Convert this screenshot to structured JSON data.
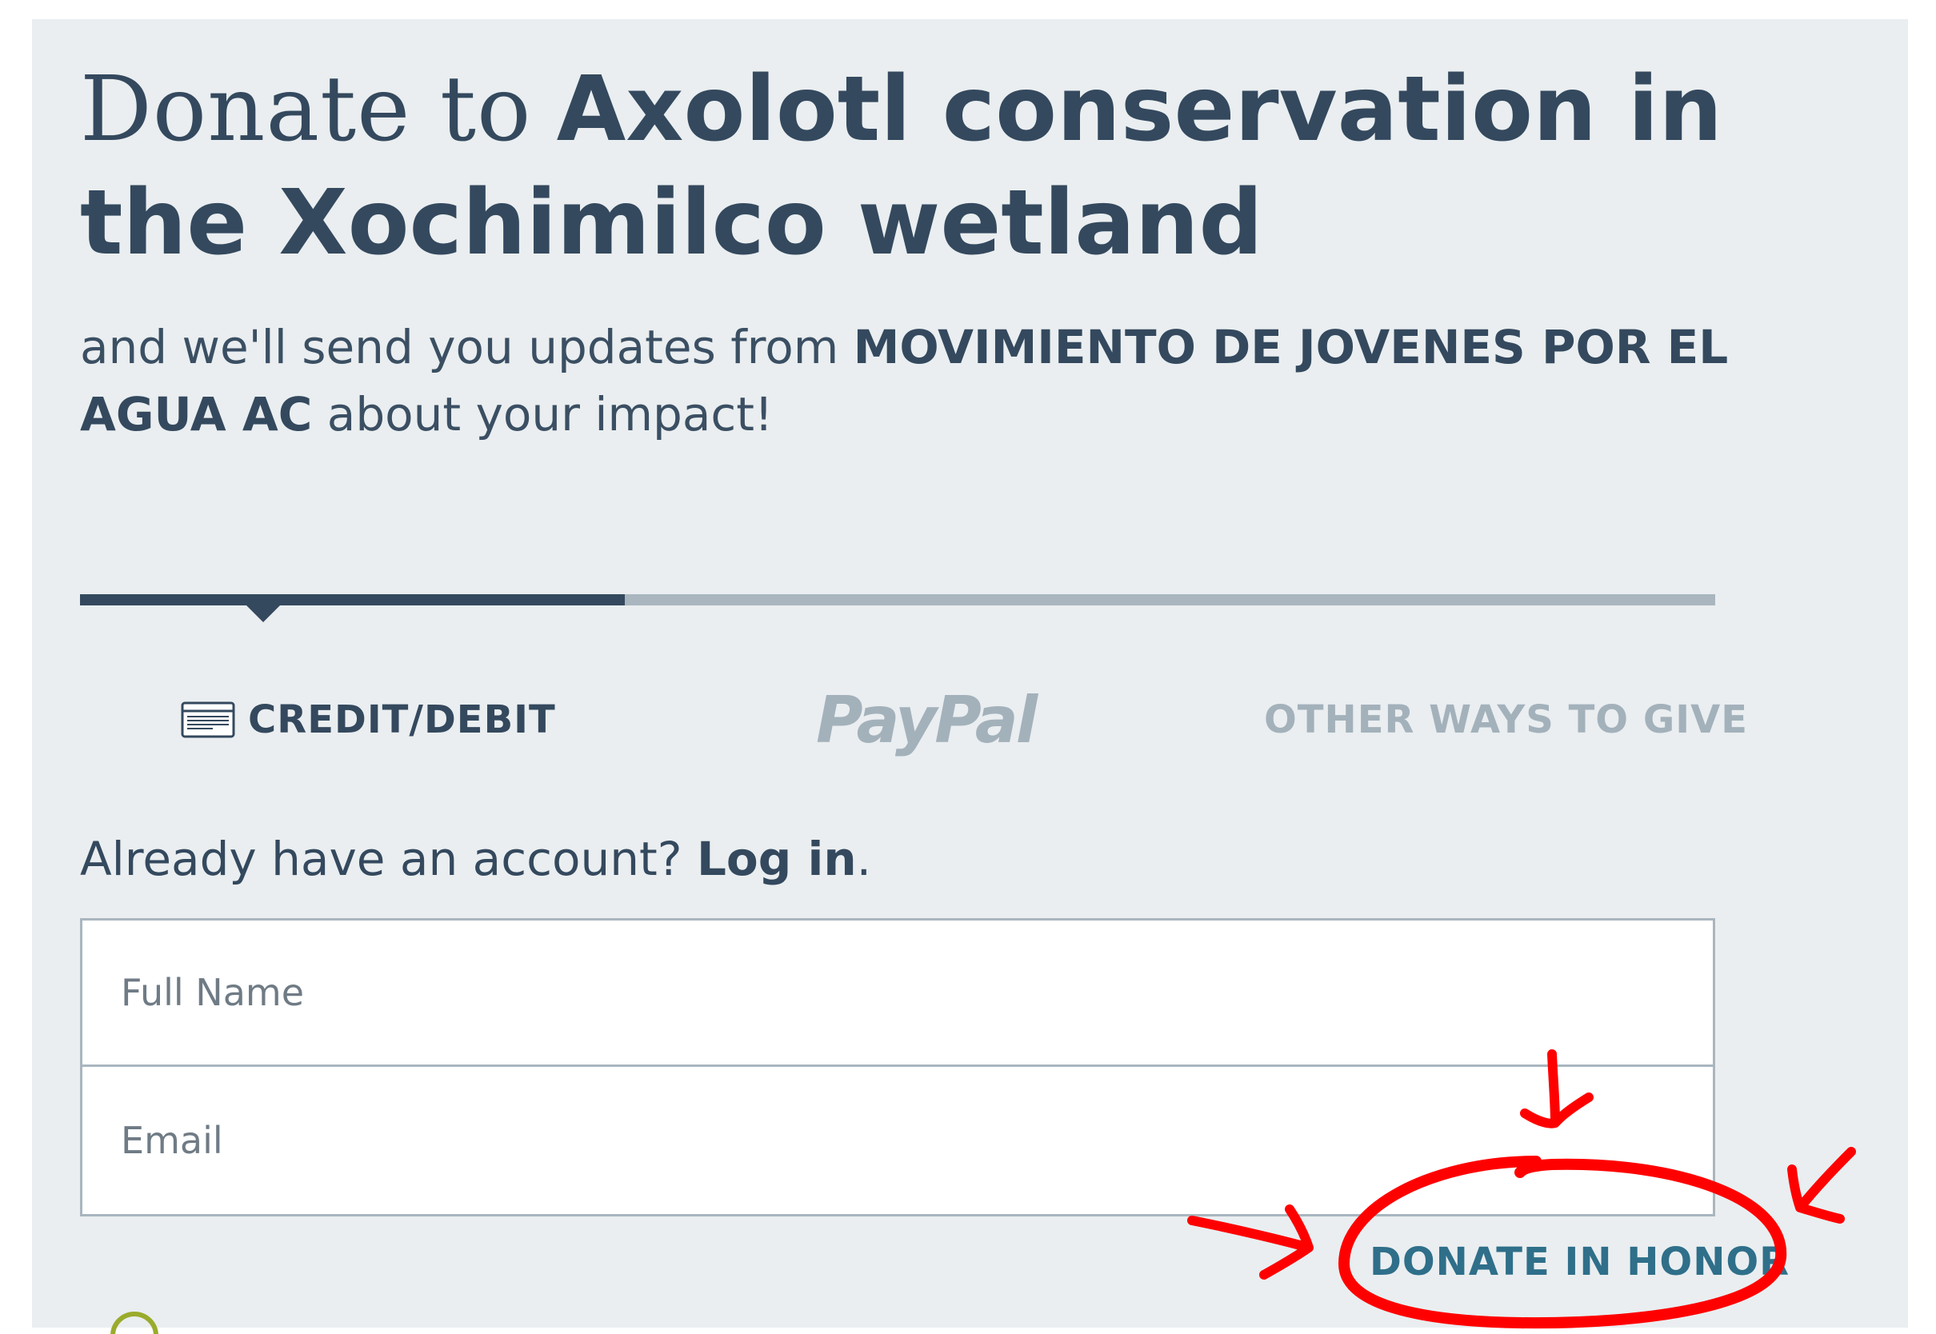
{
  "header": {
    "title_lead": "Donate to",
    "title_cause": "Axolotl conservation in the Xochimilco wetland",
    "subtitle_pre": "and we'll send you updates from",
    "subtitle_org": "MOVIMIENTO DE JOVENES POR EL AGUA AC",
    "subtitle_post": "about your impact!"
  },
  "steps": {
    "progress_fraction": 0.333
  },
  "tabs": {
    "credit_label": "CREDIT/DEBIT",
    "paypal_label": "PayPal",
    "other_label": "OTHER WAYS TO GIVE"
  },
  "login": {
    "prompt": "Already have an account?",
    "link": "Log in",
    "suffix": "."
  },
  "form": {
    "full_name_placeholder": "Full Name",
    "email_placeholder": "Email",
    "full_name_value": "",
    "email_value": ""
  },
  "donate_honor": {
    "label": "DONATE IN HONOR"
  },
  "annotation": {
    "color": "#ff0000"
  },
  "colors": {
    "panel_bg": "#eaeef0",
    "text_dark": "#34495e",
    "muted": "#a3b1bb",
    "link_teal": "#2f6f8a",
    "check_green": "#9aab2c"
  },
  "icons": {
    "credit_card": "credit-card-icon",
    "checkbox": "checkbox-circle-icon"
  }
}
